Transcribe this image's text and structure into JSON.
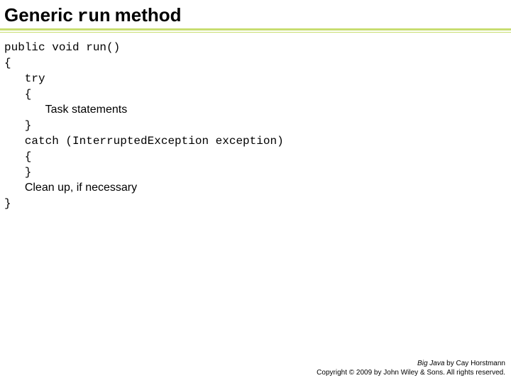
{
  "title": {
    "prefix": "Generic",
    "mono": "run",
    "suffix": "method"
  },
  "code": {
    "l1": "public void run()",
    "l2": "{",
    "l3": "   try",
    "l4": "   {",
    "l5_indent": "      ",
    "l5_text": "Task statements",
    "l6": "   }",
    "l7": "   catch (InterruptedException exception)",
    "l8": "   {",
    "l9": "   }",
    "l10_indent": "   ",
    "l10_text": "Clean up, if necessary",
    "l11": "}"
  },
  "footer": {
    "book": "Big Java",
    "byline": " by Cay Horstmann",
    "copyright": "Copyright © 2009 by John Wiley & Sons. All rights reserved."
  }
}
